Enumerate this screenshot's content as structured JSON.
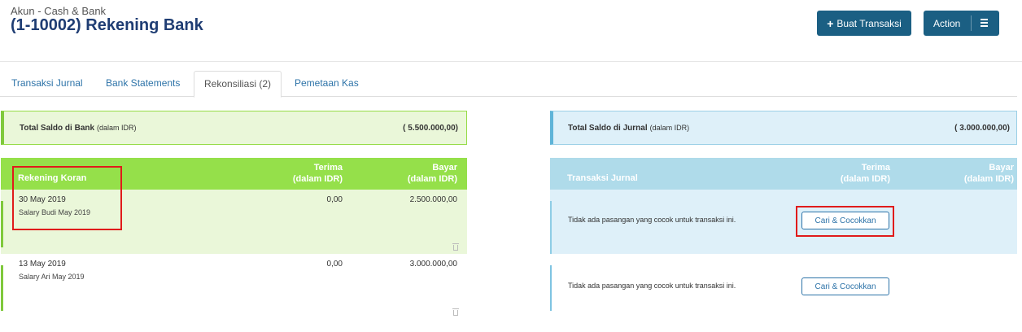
{
  "header": {
    "breadcrumb": "Akun - Cash & Bank",
    "title": "(1-10002) Rekening Bank",
    "new_transaction_label": "Buat Transaksi",
    "action_label": "Action"
  },
  "tabs": [
    {
      "label": "Transaksi Jurnal",
      "active": false
    },
    {
      "label": "Bank Statements",
      "active": false
    },
    {
      "label": "Rekonsiliasi (2)",
      "active": true
    },
    {
      "label": "Pemetaan Kas",
      "active": false
    }
  ],
  "bank": {
    "total_label": "Total Saldo di Bank",
    "total_unit": "(dalam IDR)",
    "total_value": "( 5.500.000,00)",
    "column_title": "Rekening Koran",
    "col_terima": "Terima",
    "col_bayar": "Bayar",
    "col_unit": "(dalam IDR)",
    "rows": [
      {
        "date": "30 May 2019",
        "description": "Salary Budi May 2019",
        "terima": "0,00",
        "bayar": "2.500.000,00"
      },
      {
        "date": "13 May 2019",
        "description": "Salary Ari May 2019",
        "terima": "0,00",
        "bayar": "3.000.000,00"
      }
    ]
  },
  "journal": {
    "total_label": "Total Saldo di Jurnal",
    "total_unit": "(dalam IDR)",
    "total_value": "( 3.000.000,00)",
    "column_title": "Transaksi Jurnal",
    "col_terima": "Terima",
    "col_bayar": "Bayar",
    "col_unit": "(dalam IDR)",
    "rows": [
      {
        "message": "Tidak ada pasangan yang cocok untuk transaksi ini.",
        "button": "Cari & Cocokkan"
      },
      {
        "message": "Tidak ada pasangan yang cocok untuk transaksi ini.",
        "button": "Cari & Cocokkan"
      }
    ]
  },
  "colors": {
    "primary_button": "#1b5f83",
    "title": "#1f3d73",
    "bank_header": "#95e04a",
    "journal_header": "#afdbea",
    "highlight": "#e01b1b"
  }
}
